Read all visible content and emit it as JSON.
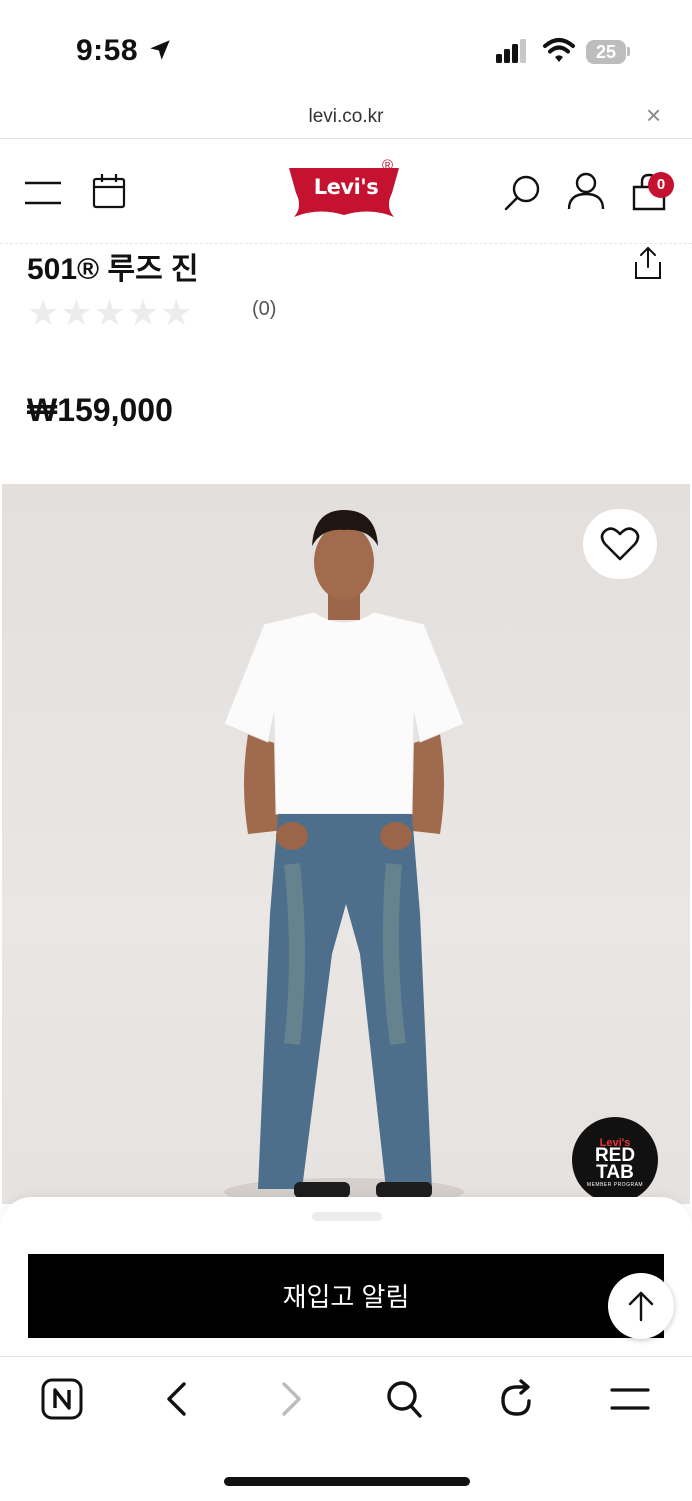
{
  "status_bar": {
    "time": "9:58",
    "battery": "25"
  },
  "browser": {
    "url": "levi.co.kr",
    "close_glyph": "×"
  },
  "header": {
    "logo_text": "Levi's",
    "logo_mark": "®",
    "cart_count": "0"
  },
  "product": {
    "title": "501® 루즈 진",
    "stars": "★★★★★",
    "rating_value": 0,
    "review_count": "(0)",
    "price": "₩159,000"
  },
  "badge": {
    "line1": "Levi's",
    "line2a": "RED",
    "line2b": "TAB",
    "line3": "MEMBER PROGRAM"
  },
  "actions": {
    "notify_label": "재입고 알림"
  },
  "colors": {
    "brand_red": "#c41230",
    "button_black": "#000000",
    "star_empty": "#ececec"
  },
  "icons": [
    "menu-icon",
    "calendar-icon",
    "search-icon",
    "user-icon",
    "cart-icon",
    "share-icon",
    "heart-icon",
    "arrow-up-icon",
    "n-icon",
    "back-icon",
    "forward-icon",
    "browser-search-icon",
    "reload-icon",
    "browser-menu-icon"
  ]
}
